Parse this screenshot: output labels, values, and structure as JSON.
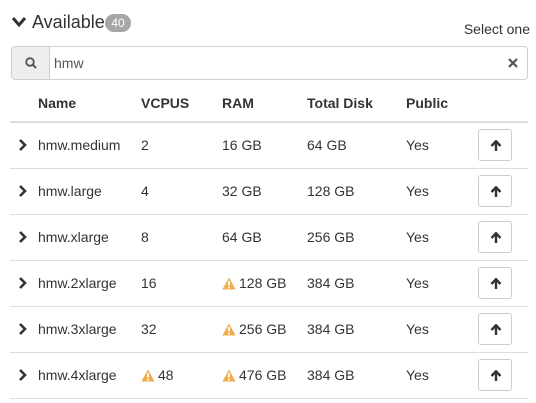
{
  "section": {
    "title": "Available",
    "count": "40",
    "hint": "Select one"
  },
  "search": {
    "value": "hmw",
    "icon": "search-icon",
    "clear_icon": "close-icon"
  },
  "table": {
    "columns": [
      "Name",
      "VCPUS",
      "RAM",
      "Total Disk",
      "Public"
    ],
    "rows": [
      {
        "name": "hmw.medium",
        "vcpus": "2",
        "vcpus_warn": false,
        "ram": "16 GB",
        "ram_warn": false,
        "disk": "64 GB",
        "public": "Yes"
      },
      {
        "name": "hmw.large",
        "vcpus": "4",
        "vcpus_warn": false,
        "ram": "32 GB",
        "ram_warn": false,
        "disk": "128 GB",
        "public": "Yes"
      },
      {
        "name": "hmw.xlarge",
        "vcpus": "8",
        "vcpus_warn": false,
        "ram": "64 GB",
        "ram_warn": false,
        "disk": "256 GB",
        "public": "Yes"
      },
      {
        "name": "hmw.2xlarge",
        "vcpus": "16",
        "vcpus_warn": false,
        "ram": "128 GB",
        "ram_warn": true,
        "disk": "384 GB",
        "public": "Yes"
      },
      {
        "name": "hmw.3xlarge",
        "vcpus": "32",
        "vcpus_warn": false,
        "ram": "256 GB",
        "ram_warn": true,
        "disk": "384 GB",
        "public": "Yes"
      },
      {
        "name": "hmw.4xlarge",
        "vcpus": "48",
        "vcpus_warn": true,
        "ram": "476 GB",
        "ram_warn": true,
        "disk": "384 GB",
        "public": "Yes"
      }
    ]
  },
  "colors": {
    "warning": "#f0ad4e",
    "badge": "#a6a6a6",
    "border": "#dddddd"
  }
}
